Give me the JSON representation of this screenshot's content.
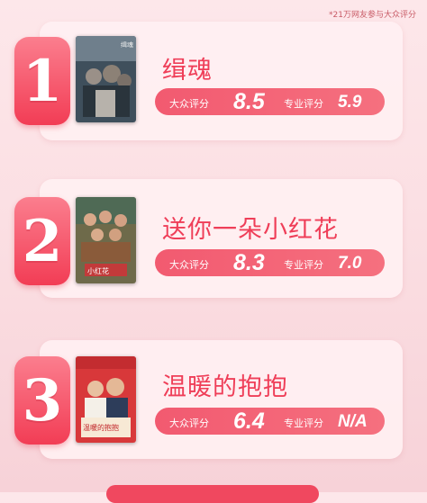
{
  "note": "*21万网友参与大众评分",
  "labels": {
    "public": "大众评分",
    "pro": "专业评分"
  },
  "ranking": [
    {
      "rank": "1",
      "title": "缉魂",
      "public_score": "8.5",
      "pro_score": "5.9",
      "poster": "缉魂 movie poster"
    },
    {
      "rank": "2",
      "title": "送你一朵小红花",
      "public_score": "8.3",
      "pro_score": "7.0",
      "poster": "送你一朵小红花 movie poster"
    },
    {
      "rank": "3",
      "title": "温暖的抱抱",
      "public_score": "6.4",
      "pro_score": "N/A",
      "poster": "温暖的抱抱 movie poster"
    }
  ],
  "colors": {
    "accent": "#ef3e58",
    "bar": "#f25a70",
    "card": "#fff0f2"
  }
}
